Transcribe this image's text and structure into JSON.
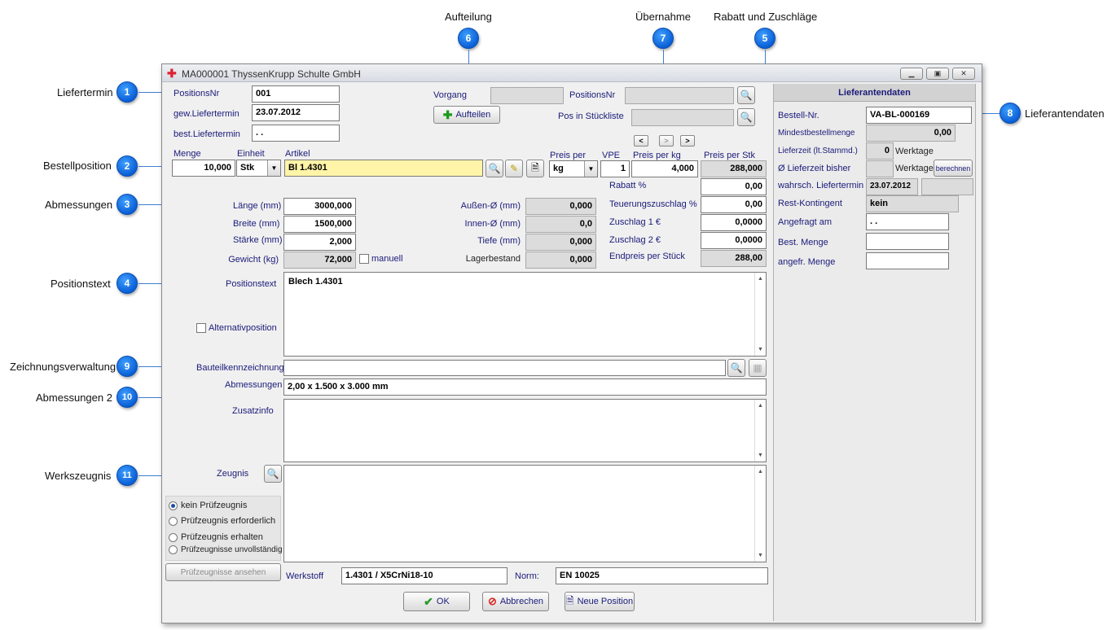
{
  "callouts": {
    "liefertermin": {
      "num": "1",
      "label": "Liefertermin"
    },
    "bestellposition": {
      "num": "2",
      "label": "Bestellposition"
    },
    "abmessungen": {
      "num": "3",
      "label": "Abmessungen"
    },
    "positionstext": {
      "num": "4",
      "label": "Positionstext"
    },
    "rabatt": {
      "num": "5",
      "label": "Rabatt und Zuschläge"
    },
    "aufteilung": {
      "num": "6",
      "label": "Aufteilung"
    },
    "uebernahme": {
      "num": "7",
      "label": "Übernahme"
    },
    "lieferantendaten": {
      "num": "8",
      "label": "Lieferantendaten"
    },
    "zeichnungsverwaltung": {
      "num": "9",
      "label": "Zeichnungsverwaltung"
    },
    "abmessungen2": {
      "num": "10",
      "label": "Abmessungen 2"
    },
    "werkszeugnis": {
      "num": "11",
      "label": "Werkszeugnis"
    }
  },
  "window": {
    "title": "MA000001 ThyssenKrupp Schulte GmbH"
  },
  "header": {
    "positionsnr_label": "PositionsNr",
    "positionsnr_value": "001",
    "gew_label": "gew.Liefertermin",
    "gew_value": "23.07.2012",
    "best_label": "best.Liefertermin",
    "best_value": " . .",
    "vorgang_label": "Vorgang",
    "vorgang_value": "",
    "posnr2_label": "PositionsNr",
    "posnr2_value": "",
    "aufteilen_button": "Aufteilen",
    "posstueck_label": "Pos in  Stückliste",
    "posstueck_value": ""
  },
  "nav": {
    "prev": "<",
    "mid": ">",
    "next": ">"
  },
  "position": {
    "menge_label": "Menge",
    "menge_value": "10,000",
    "einheit_label": "Einheit",
    "einheit_value": "Stk",
    "artikel_label": "Artikel",
    "artikel_value": "Bl 1.4301",
    "preisper_label": "Preis per",
    "preisper_value": "kg",
    "vpe_label": "VPE",
    "vpe_value": "1",
    "preisperkg_label": "Preis per kg",
    "preisperkg_value": "4,000",
    "preisperstk_label": "Preis per Stk",
    "preisperstk_value": "288,000"
  },
  "dimensions": {
    "laenge_label": "Länge (mm)",
    "laenge_value": "3000,000",
    "breite_label": "Breite (mm)",
    "breite_value": "1500,000",
    "staerke_label": "Stärke (mm)",
    "staerke_value": "2,000",
    "gewicht_label": "Gewicht (kg)",
    "gewicht_value": "72,000",
    "manuell_label": "manuell",
    "aussen_label": "Außen-Ø (mm)",
    "aussen_value": "0,000",
    "innen_label": "Innen-Ø (mm)",
    "innen_value": "0,0",
    "tiefe_label": "Tiefe (mm)",
    "tiefe_value": "0,000",
    "lager_label": "Lagerbestand",
    "lager_value": "0,000"
  },
  "pricing": {
    "rabatt_label": "Rabatt %",
    "rabatt_value": "0,00",
    "teuerung_label": "Teuerungszuschlag %",
    "teuerung_value": "0,00",
    "zuschlag1_label": "Zuschlag 1 €",
    "zuschlag1_value": "0,0000",
    "zuschlag2_label": "Zuschlag 2 €",
    "zuschlag2_value": "0,0000",
    "endpreis_label": "Endpreis per Stück",
    "endpreis_value": "288,00"
  },
  "text": {
    "positionstext_label": "Positionstext",
    "positionstext_value": "Blech 1.4301",
    "alternativ_label": "Alternativposition",
    "bauteil_label": "Bauteilkennzeichnung",
    "bauteil_value": "",
    "abm_label": "Abmessungen",
    "abm_value": "2,00 x  1.500 x  3.000 mm",
    "zusatz_label": "Zusatzinfo",
    "zusatz_value": "",
    "zeugnis_label": "Zeugnis",
    "zeugnis_value": ""
  },
  "certificate": {
    "options": [
      "kein Prüfzeugnis",
      "Prüfzeugnis erforderlich",
      "Prüfzeugnis erhalten",
      "Prüfzeugnisse unvollständig"
    ],
    "ansehen_button": "Prüfzeugnisse ansehen",
    "werkstoff_label": "Werkstoff",
    "werkstoff_value": "1.4301 / X5CrNi18-10",
    "norm_label": "Norm:",
    "norm_value": "EN 10025"
  },
  "actions": {
    "ok": "OK",
    "abbrechen": "Abbrechen",
    "neu": "Neue Position"
  },
  "supplier": {
    "title": "Lieferantendaten",
    "bestellnr_label": "Bestell-Nr.",
    "bestellnr_value": "VA-BL-000169",
    "mindest_label": "Mindestbestellmenge",
    "mindest_value": "0,00",
    "lieferzeit_label": "Lieferzeit (lt.Stammd.)",
    "lieferzeit_value": "0",
    "werktage1": "Werktage",
    "bisher_label": "Ø Lieferzeit bisher",
    "bisher_value": "",
    "werktage2": "Werktage",
    "berechnen_button": "berechnen",
    "wahrsch_label": "wahrsch. Liefertermin",
    "wahrsch_value": "23.07.2012",
    "wahrsch_extra": "",
    "rest_label": "Rest-Kontingent",
    "rest_value": "kein",
    "angefragt_label": "Angefragt am",
    "angefragt_value": " . .",
    "bestmenge_label": "Best. Menge",
    "bestmenge_value": "",
    "angefrmenge_label": "angefr. Menge",
    "angefrmenge_value": ""
  },
  "icons": {
    "search": "magnifier-icon",
    "plus": "plus-icon",
    "doc": "document-icon",
    "ok": "check-icon",
    "cancel": "cancel-icon"
  }
}
